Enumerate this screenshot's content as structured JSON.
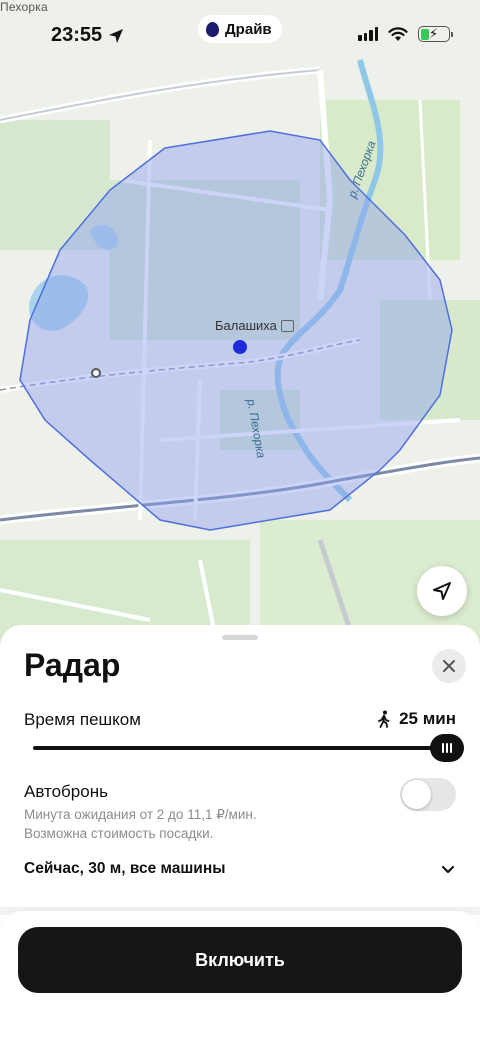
{
  "status_bar": {
    "time": "23:55",
    "app_pill": "Драйв"
  },
  "map": {
    "labels": {
      "top_left": "Пехорка",
      "city": "Балашиха",
      "river_north": "р. Пехорка",
      "river_south": "р. Пехорка"
    },
    "colors": {
      "radar_fill": "#8f9ff0",
      "radar_stroke": "#4f6fe0",
      "user_dot": "#1f2bd9"
    }
  },
  "sheet": {
    "title": "Радар",
    "walk_time_label": "Время пешком",
    "walk_time_value": "25 мин",
    "walk_slider_fraction": 1.0,
    "autobron_label": "Автобронь",
    "autobron_enabled": false,
    "autobron_desc_line1": "Минута ожидания от 2 до 11,1 ₽/мин.",
    "autobron_desc_line2": "Возможна стоимость посадки.",
    "options_text": "Сейчас, 30 м, все машины",
    "enable_button_label": "Включить"
  },
  "icons": [
    "location-arrow-icon",
    "drive-logo-icon",
    "signal-icon",
    "wifi-icon",
    "battery-icon",
    "navigation-icon",
    "close-icon",
    "walking-icon",
    "slider-grip-icon",
    "chevron-down-icon",
    "station-icon"
  ]
}
